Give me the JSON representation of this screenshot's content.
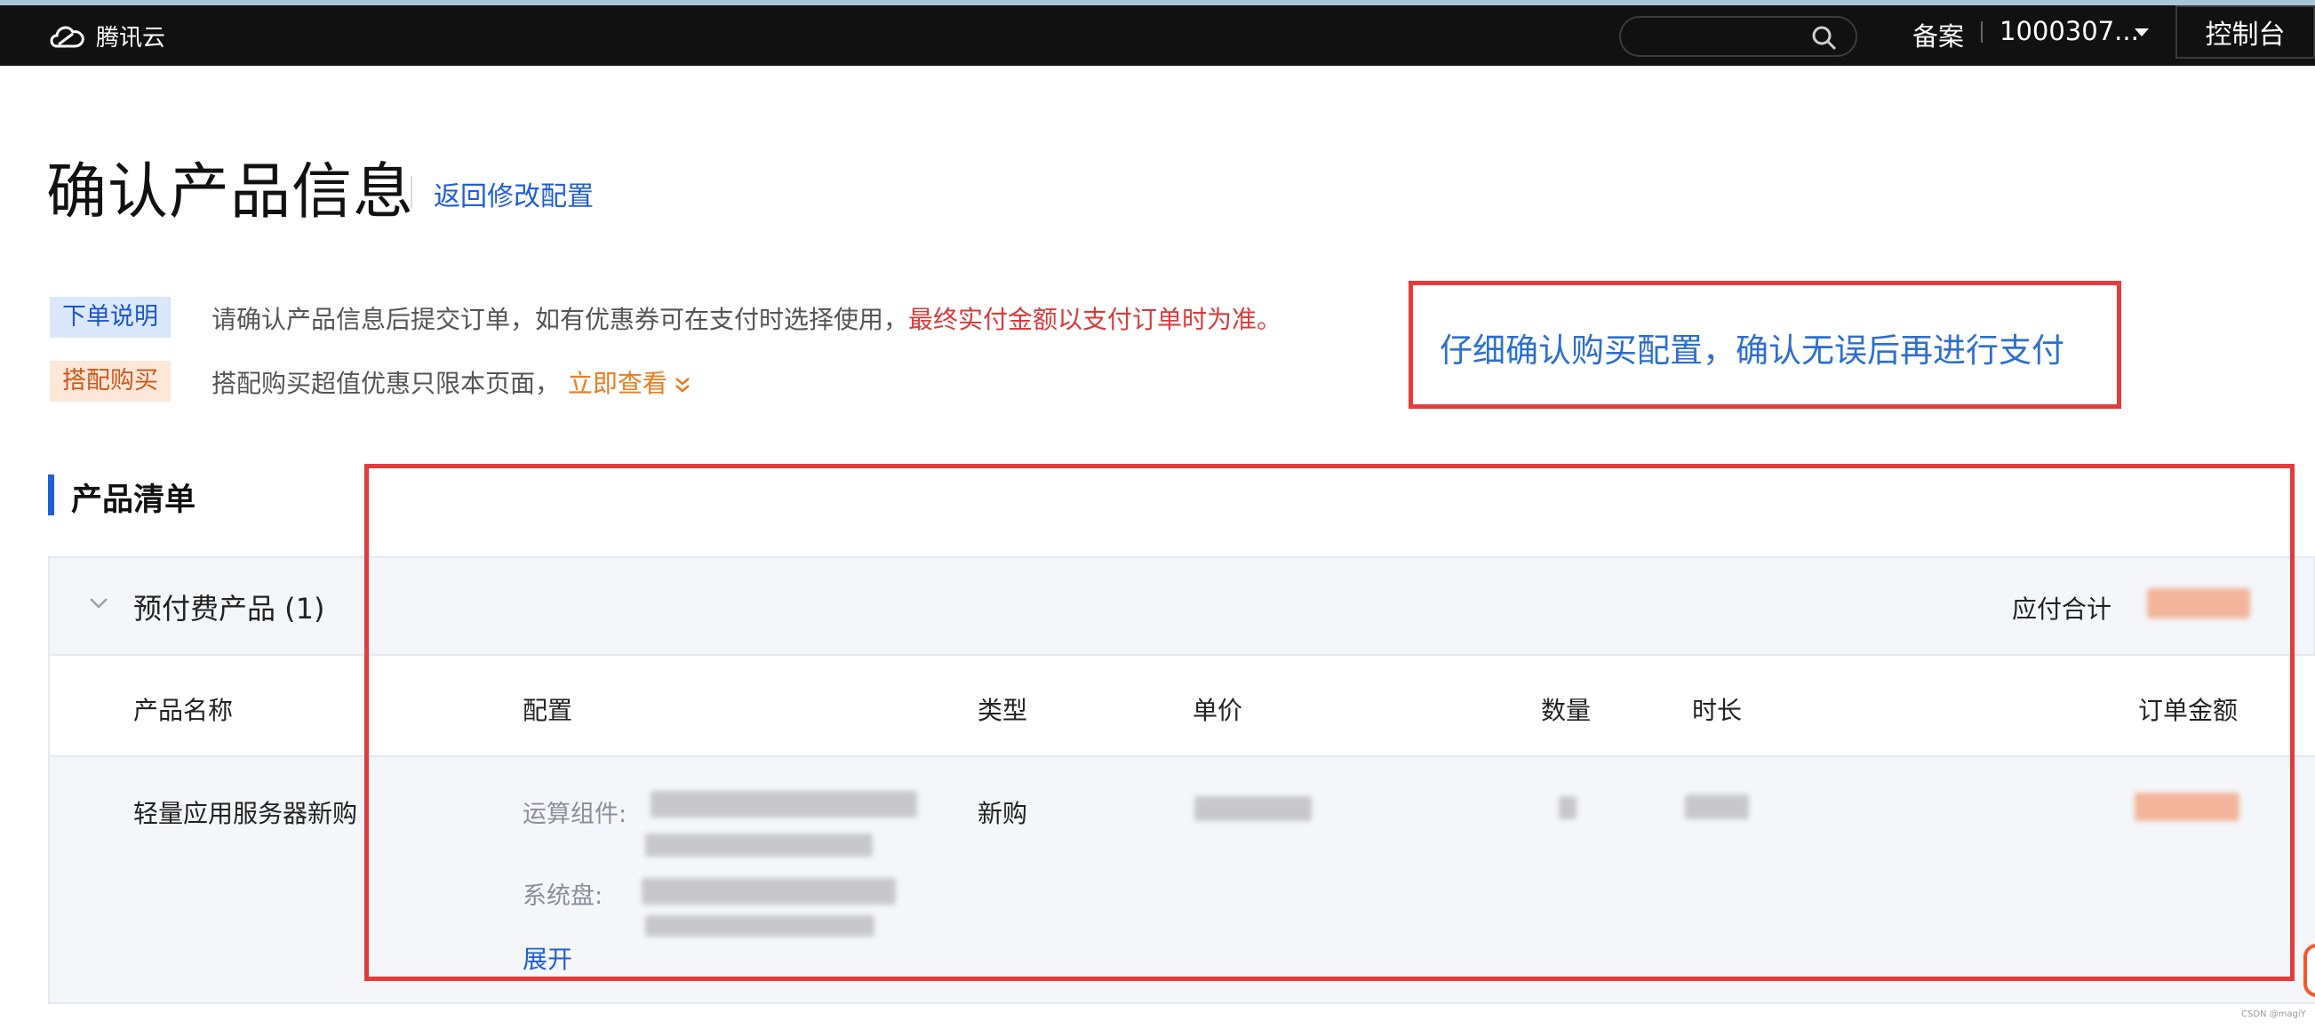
{
  "header": {
    "brand": "腾讯云",
    "search_placeholder": "",
    "beian": "备案",
    "account": "1000307...",
    "console": "控制台"
  },
  "page": {
    "title": "确认产品信息",
    "back_link": "返回修改配置"
  },
  "notices": {
    "order_tag": "下单说明",
    "order_text": "请确认产品信息后提交订单，如有优惠券可在支付时选择使用，",
    "order_text_red": "最终实付金额以支付订单时为准。",
    "bundle_tag": "搭配购买",
    "bundle_text": "搭配购买超值优惠只限本页面，",
    "bundle_link": "立即查看"
  },
  "annotation": {
    "hint": "仔细确认购买配置，确认无误后再进行支付"
  },
  "product_list": {
    "section_title": "产品清单",
    "group_title": "预付费产品 (1)",
    "total_label": "应付合计",
    "columns": [
      "产品名称",
      "配置",
      "类型",
      "单价",
      "数量",
      "时长",
      "订单金额"
    ],
    "rows": [
      {
        "name": "轻量应用服务器新购",
        "config_compute_label": "运算组件:",
        "config_disk_label": "系统盘:",
        "type": "新购"
      }
    ],
    "expand_label": "展开"
  },
  "watermark": "CSDN @magiY"
}
